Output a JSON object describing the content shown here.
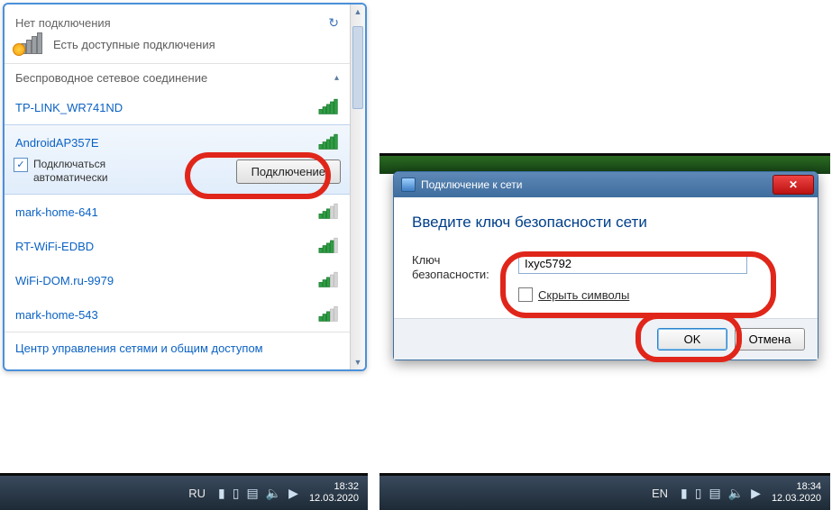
{
  "flyout": {
    "status_title": "Нет подключения",
    "status_sub": "Есть доступные подключения",
    "group_title": "Беспроводное сетевое соединение",
    "networks": [
      {
        "ssid": "TP-LINK_WR741ND",
        "strength": "full"
      },
      {
        "ssid": "AndroidAP357E",
        "strength": "full",
        "selected": true
      },
      {
        "ssid": "mark-home-641",
        "strength": "weak"
      },
      {
        "ssid": "RT-WiFi-EDBD",
        "strength": "mid"
      },
      {
        "ssid": "WiFi-DOM.ru-9979",
        "strength": "weak"
      },
      {
        "ssid": "mark-home-543",
        "strength": "weak"
      }
    ],
    "auto_connect_label": "Подключаться\nавтоматически",
    "auto_connect_checked": true,
    "connect_button": "Подключение",
    "footer_link": "Центр управления сетями и общим доступом"
  },
  "dialog": {
    "title": "Подключение к сети",
    "heading": "Введите ключ безопасности сети",
    "key_label": "Ключ\nбезопасности:",
    "key_value": "Ixyc5792",
    "hide_chars_label": "Скрыть символы",
    "hide_chars_checked": false,
    "ok": "OK",
    "cancel": "Отмена"
  },
  "taskbar1": {
    "lang": "RU",
    "time": "18:32",
    "date": "12.03.2020"
  },
  "taskbar2": {
    "lang": "EN",
    "time": "18:34",
    "date": "12.03.2020"
  }
}
